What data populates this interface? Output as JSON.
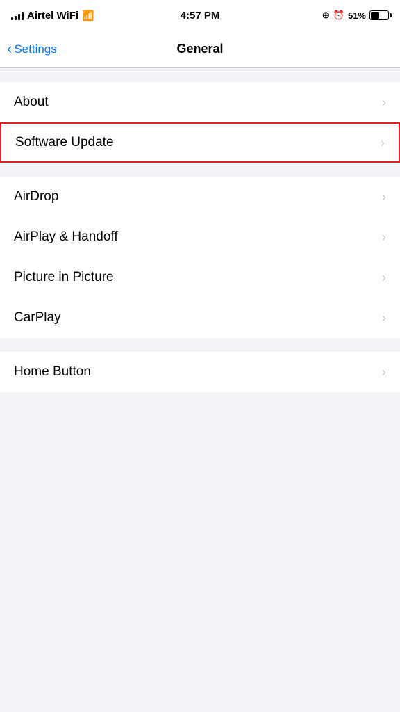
{
  "statusBar": {
    "carrier": "Airtel WiFi",
    "time": "4:57 PM",
    "battery_percent": "51%"
  },
  "navBar": {
    "back_label": "Settings",
    "title": "General"
  },
  "sections": [
    {
      "id": "section1",
      "items": [
        {
          "id": "about",
          "label": "About"
        },
        {
          "id": "software-update",
          "label": "Software Update",
          "highlighted": true
        }
      ]
    },
    {
      "id": "section2",
      "items": [
        {
          "id": "airdrop",
          "label": "AirDrop"
        },
        {
          "id": "airplay-handoff",
          "label": "AirPlay & Handoff"
        },
        {
          "id": "picture-in-picture",
          "label": "Picture in Picture"
        },
        {
          "id": "carplay",
          "label": "CarPlay"
        }
      ]
    },
    {
      "id": "section3",
      "items": [
        {
          "id": "home-button",
          "label": "Home Button"
        }
      ]
    }
  ],
  "chevron": "›"
}
